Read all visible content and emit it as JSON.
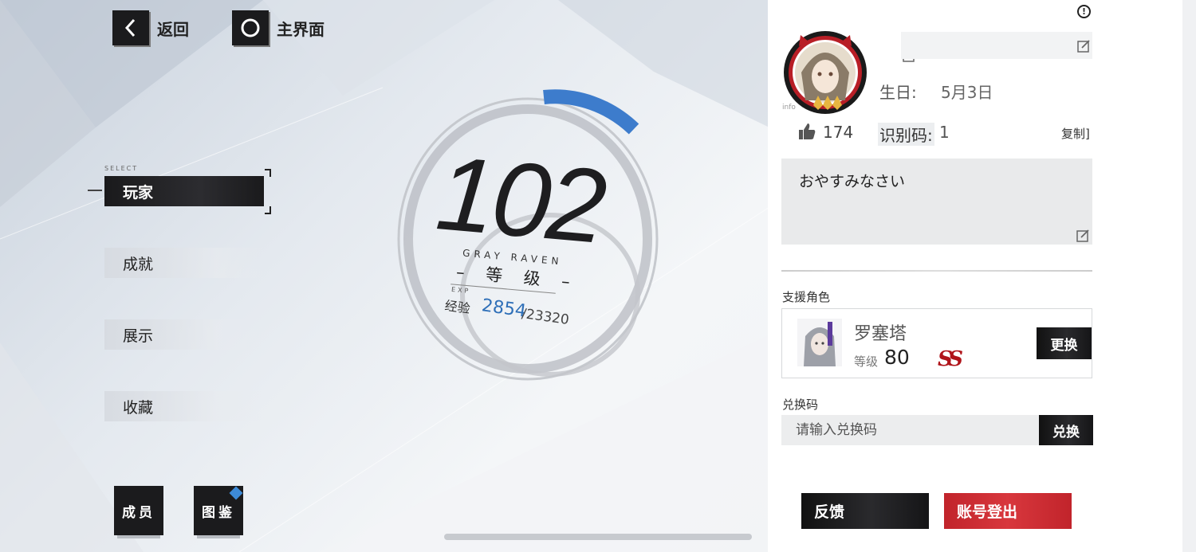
{
  "nav": {
    "back_label": "返回",
    "home_label": "主界面"
  },
  "menu": {
    "select_caption": "SELECT",
    "items": [
      {
        "label": "玩家",
        "active": true
      },
      {
        "label": "成就",
        "active": false
      },
      {
        "label": "展示",
        "active": false
      },
      {
        "label": "收藏",
        "active": false
      }
    ]
  },
  "bottom_buttons": {
    "members_label": "成员",
    "archive_label": "图鉴"
  },
  "level": {
    "value": "102",
    "caption": "GRAY RAVEN",
    "label": "– 等 级 –",
    "exp_caption": "EXP",
    "exp_label": "经验",
    "exp_current": "2854",
    "exp_max": "/23320"
  },
  "profile": {
    "info_tag": "info",
    "birthday_label": "生日:",
    "birthday_value": "5月3日",
    "likes": "174",
    "uid_label": "识别码:",
    "uid_value": "1",
    "copy_label": "复制]",
    "signature": "おやすみなさい"
  },
  "support": {
    "section_label": "支援角色",
    "name": "罗塞塔",
    "level_label": "等级",
    "level": "80",
    "rank": "SS",
    "change_label": "更换"
  },
  "redeem": {
    "section_label": "兑换码",
    "placeholder": "请输入兑换码",
    "button_label": "兑换"
  },
  "footer": {
    "feedback_label": "反馈",
    "logout_label": "账号登出"
  },
  "colors": {
    "accent_blue": "#3d7ccc",
    "logout_red": "#d0313a",
    "rank_red": "#b0141a"
  }
}
